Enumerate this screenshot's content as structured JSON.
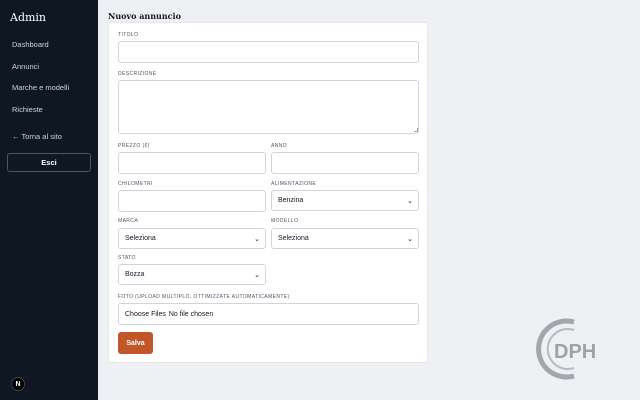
{
  "sidebar": {
    "brand": "Admin",
    "items": [
      {
        "label": "Dashboard"
      },
      {
        "label": "Annunci"
      },
      {
        "label": "Marche e modelli"
      },
      {
        "label": "Richieste"
      }
    ],
    "back_link": "← Torna al sito",
    "logout_label": "Esci",
    "badge_letter": "N"
  },
  "page": {
    "title": "Nuovo annuncio"
  },
  "form": {
    "titolo_label": "TITOLO",
    "titolo_value": "",
    "descrizione_label": "DESCRIZIONE",
    "descrizione_value": "",
    "prezzo_label": "PREZZO (€)",
    "prezzo_value": "",
    "anno_label": "ANNO",
    "anno_value": "",
    "chilometri_label": "CHILOMETRI",
    "chilometri_value": "",
    "alimentazione_label": "ALIMENTAZIONE",
    "alimentazione_value": "Benzina",
    "marca_label": "MARCA",
    "marca_value": "Seleziona",
    "modello_label": "MODELLO",
    "modello_value": "Seleziona",
    "stato_label": "STATO",
    "stato_value": "Bozza",
    "foto_label": "FOTO (UPLOAD MULTIPLO, OTTIMIZZATE AUTOMATICAMENTE)",
    "foto_button": "Choose Files",
    "foto_status": "No file chosen",
    "save_label": "Salva"
  },
  "watermark": {
    "text": "DPH"
  },
  "colors": {
    "sidebar_bg": "#0f1722",
    "accent": "#c2552a",
    "page_bg": "#eef0f3"
  }
}
